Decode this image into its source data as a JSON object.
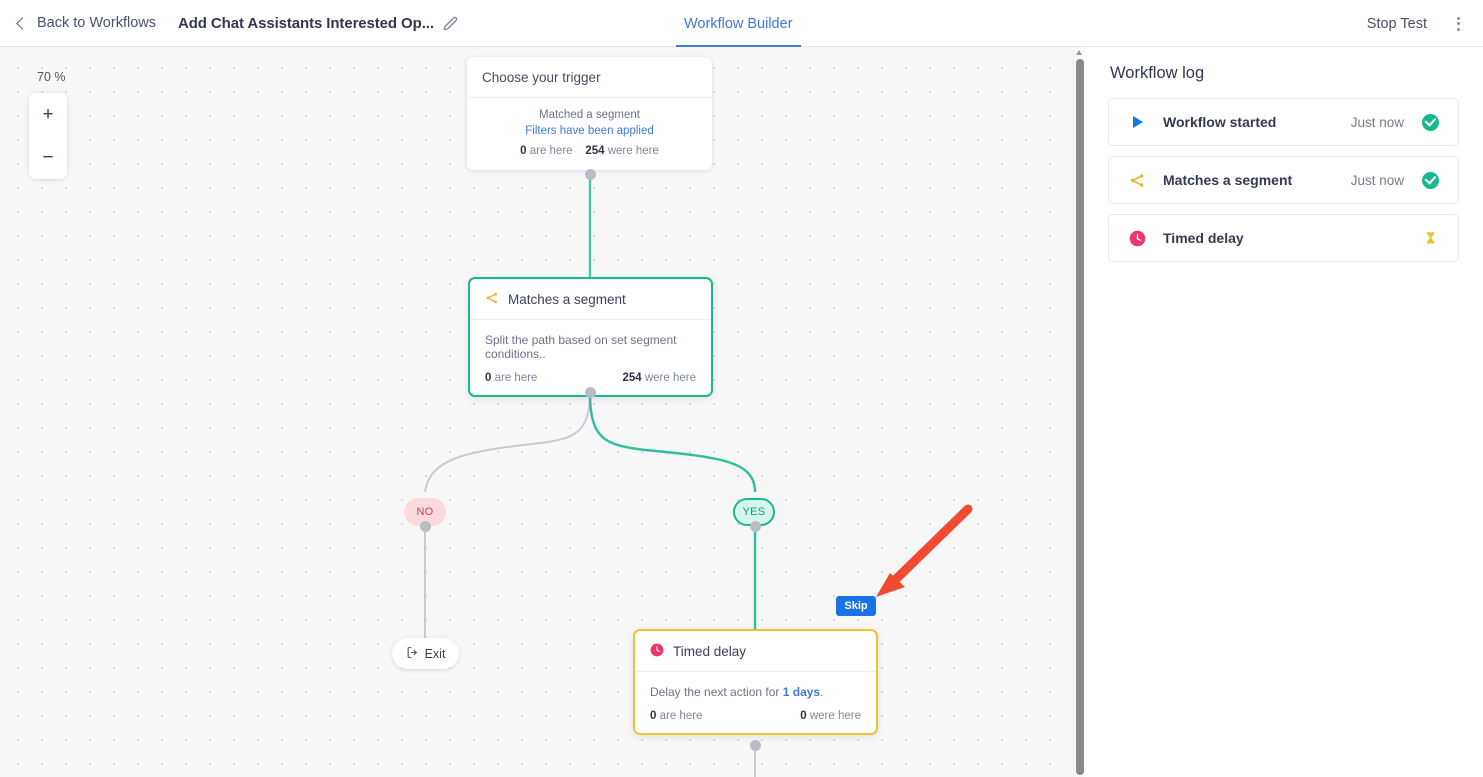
{
  "header": {
    "back_label": "Back to Workflows",
    "workflow_title": "Add Chat Assistants Interested Op...",
    "edit_icon": "pencil-icon",
    "tab_label": "Workflow Builder",
    "stop_test_label": "Stop Test",
    "menu_icon": "kebab-menu-icon",
    "accent": "#3f78e0"
  },
  "canvas": {
    "zoom_level": "70 %",
    "zoom_in": "+",
    "zoom_out": "−",
    "trigger": {
      "header": "Choose your trigger",
      "matched": "Matched a segment",
      "filters_link": "Filters have been applied",
      "here_count": "0",
      "here_label": "are here",
      "were_count": "254",
      "were_label": "were here"
    },
    "segment": {
      "title": "Matches a segment",
      "icon": "branch-split-icon",
      "description": "Split the path based on set segment conditions..",
      "here_count": "0",
      "here_label": "are here",
      "were_count": "254",
      "were_label": "were here",
      "border_color": "#16bb92"
    },
    "branches": {
      "no": "NO",
      "yes": "YES"
    },
    "exit": {
      "label": "Exit",
      "icon": "exit-arrow-icon"
    },
    "skip_button": "Skip",
    "delay": {
      "title": "Timed delay",
      "icon": "clock-icon",
      "description_prefix": "Delay the next action for ",
      "description_value": "1 days",
      "description_suffix": ".",
      "here_count": "0",
      "here_label": "are here",
      "were_count": "0",
      "were_label": "were here",
      "border_color": "#f1c232"
    },
    "annotation_arrow": "red-arrow-pointing-to-skip"
  },
  "log": {
    "title": "Workflow log",
    "rows": [
      {
        "icon": "play-icon",
        "label": "Workflow started",
        "time": "Just now",
        "status": "success-check-icon"
      },
      {
        "icon": "branch-split-icon",
        "label": "Matches a segment",
        "time": "Just now",
        "status": "success-check-icon"
      },
      {
        "icon": "clock-icon",
        "label": "Timed delay",
        "time": "",
        "status": "hourglass-icon"
      }
    ]
  }
}
